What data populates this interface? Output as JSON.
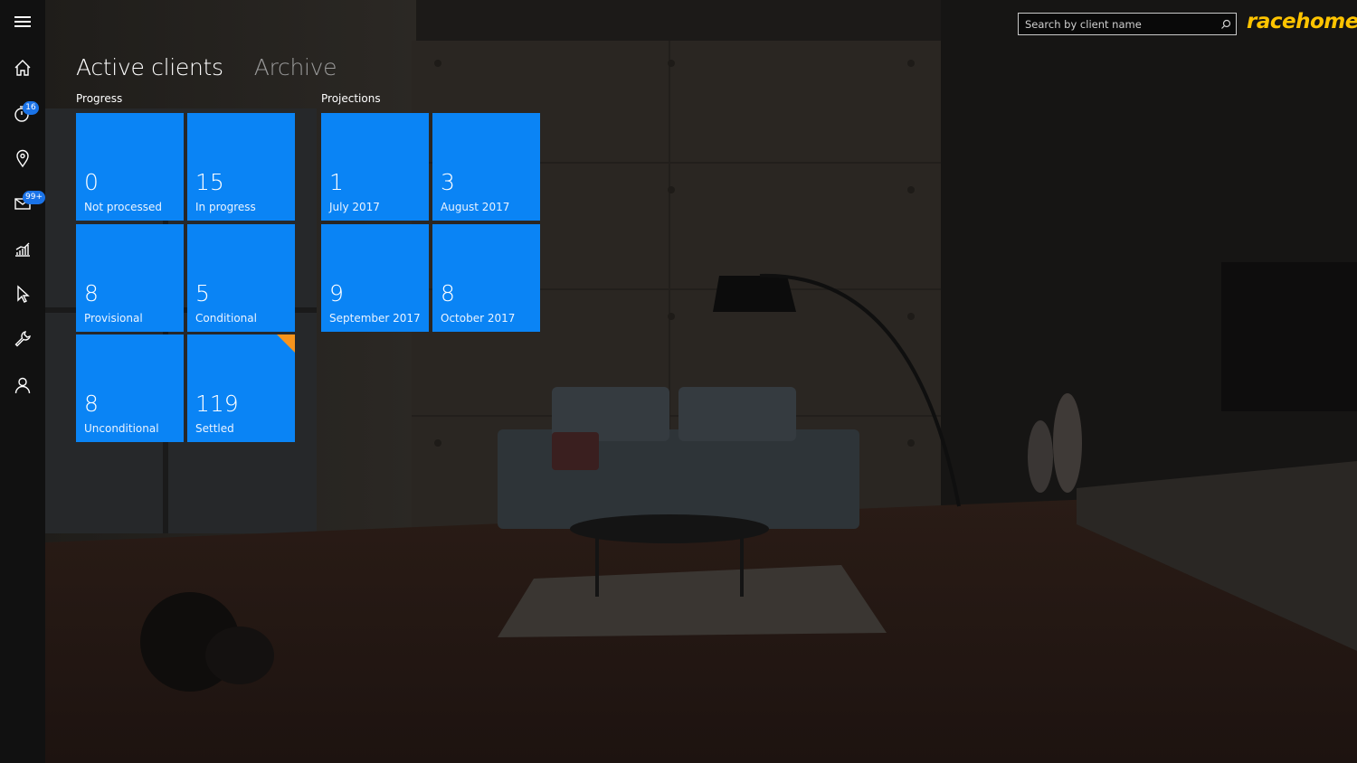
{
  "brand": {
    "name": "racehome",
    "color": "#ffc400"
  },
  "search": {
    "placeholder": "Search by client name",
    "icon": "search-icon"
  },
  "tabs": [
    {
      "label": "Active clients",
      "active": true
    },
    {
      "label": "Archive",
      "active": false
    }
  ],
  "rail": [
    {
      "icon": "menu-icon"
    },
    {
      "icon": "home-icon"
    },
    {
      "icon": "timer-icon",
      "badge": "16"
    },
    {
      "icon": "location-pin-icon"
    },
    {
      "icon": "mail-icon",
      "badge": "99+"
    },
    {
      "icon": "chart-icon"
    },
    {
      "icon": "cursor-icon"
    },
    {
      "icon": "wrench-icon"
    },
    {
      "icon": "user-icon"
    }
  ],
  "progress": {
    "label": "Progress",
    "tiles": [
      {
        "value": "0",
        "label": "Not processed"
      },
      {
        "value": "15",
        "label": "In progress"
      },
      {
        "value": "8",
        "label": "Provisional"
      },
      {
        "value": "5",
        "label": "Conditional"
      },
      {
        "value": "8",
        "label": "Unconditional"
      },
      {
        "value": "119",
        "label": "Settled",
        "flag": true
      }
    ]
  },
  "projections": {
    "label": "Projections",
    "tiles": [
      {
        "value": "1",
        "label": "July 2017"
      },
      {
        "value": "3",
        "label": "August 2017"
      },
      {
        "value": "9",
        "label": "September 2017"
      },
      {
        "value": "8",
        "label": "October 2017"
      }
    ]
  },
  "colors": {
    "tile": "#0a84f5",
    "flag": "#f7941d",
    "badge": "#1a73e8",
    "rail": "#111111"
  }
}
